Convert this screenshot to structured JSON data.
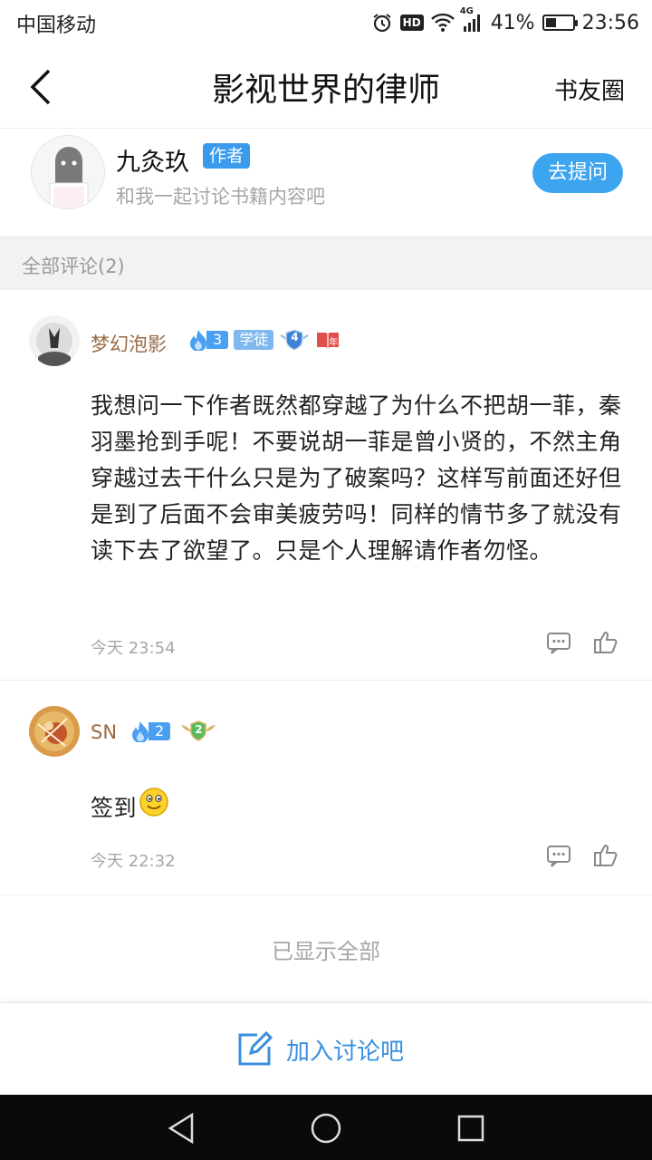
{
  "status_bar": {
    "carrier": "中国移动",
    "hd": "HD",
    "network": "4G",
    "battery": "41%",
    "battery_level": 0.41,
    "time": "23:56"
  },
  "nav": {
    "title": "影视世界的律师",
    "right_label": "书友圈",
    "back_icon": "chevron-left-icon"
  },
  "author": {
    "name": "九灸玖",
    "badge": "作者",
    "subtitle": "和我一起讨论书籍内容吧",
    "ask_button": "去提问"
  },
  "section": {
    "label": "全部评论(2)"
  },
  "comments": [
    {
      "user": "梦幻泡影",
      "fire_level": "3",
      "title_badge": "学徒",
      "shield_level": "4",
      "year_badge": "年",
      "content": "我想问一下作者既然都穿越了为什么不把胡一菲，秦羽墨抢到手呢！不要说胡一菲是曾小贤的，不然主角穿越过去干什么只是为了破案吗？这样写前面还好但是到了后面不会审美疲劳吗！同样的情节多了就没有读下去了欲望了。只是个人理解请作者勿怪。",
      "time": "今天 23:54"
    },
    {
      "user": "SN",
      "fire_level": "2",
      "wing_level": "2",
      "content": "签到",
      "time": "今天 22:32"
    }
  ],
  "footer_note": "已显示全部",
  "join": {
    "label": "加入讨论吧"
  },
  "colors": {
    "accent": "#3da5f0",
    "username": "#9a6b44",
    "muted": "#a6a6a6",
    "section_bg": "#f2f2f2"
  }
}
